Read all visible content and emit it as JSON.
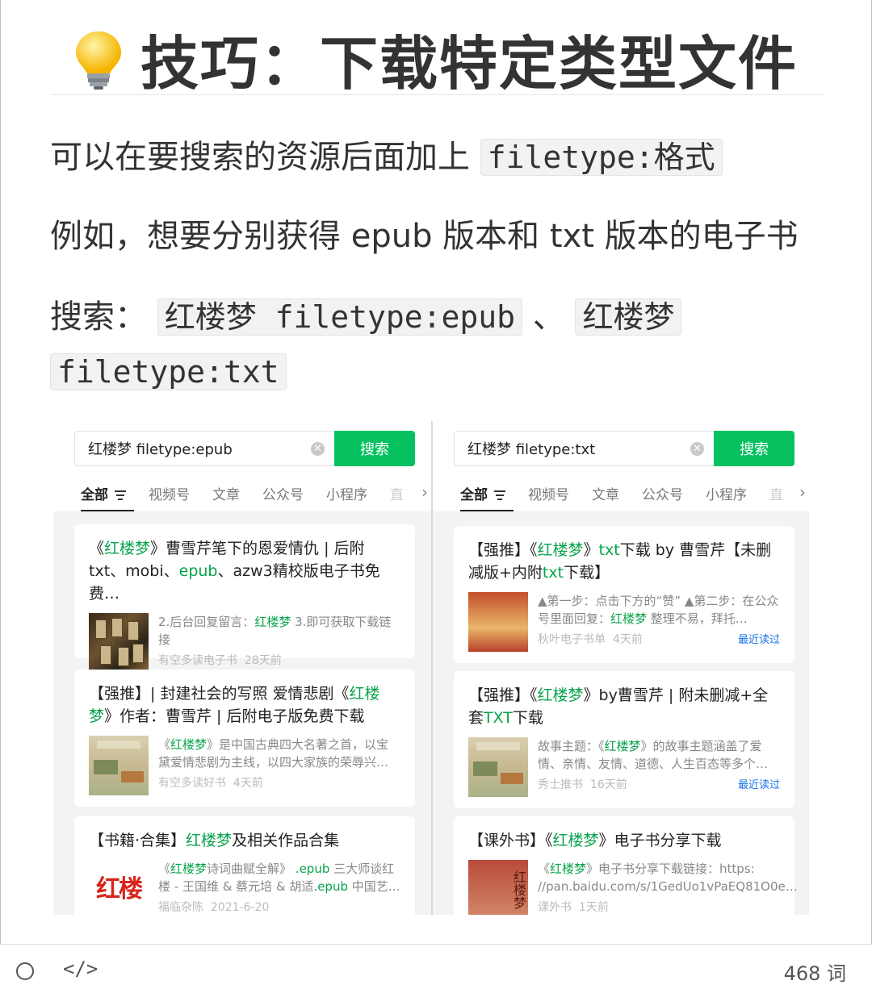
{
  "heading": {
    "text": "技巧：下载特定类型文件",
    "icon": "lightbulb-icon"
  },
  "paragraphs": {
    "p1_text": "可以在要搜索的资源后面加上",
    "p1_code": "filetype:格式",
    "p2_text": "例如，想要分别获得 epub 版本和 txt 版本的电子书",
    "p3_label": "搜索：",
    "p3_code1": "红楼梦 filetype:epub",
    "p3_sep": "、",
    "p3_code2a": "红楼梦",
    "p4_code2b": "filetype:txt"
  },
  "left_panel": {
    "search_value": "红楼梦 filetype:epub",
    "search_button": "搜索",
    "tabs": [
      "全部",
      "视频号",
      "文章",
      "公众号",
      "小程序",
      "直"
    ],
    "cards": [
      {
        "title_pre": "《",
        "title_hl": "红楼梦",
        "title_post": "》曹雪芹笔下的恩爱情仇 | 后附txt、mobi、",
        "title_hl2": "epub",
        "title_post2": "、azw3精校版电子书免费…",
        "snippet_pre": "2.后台回复留言：",
        "snippet_hl": "红楼梦",
        "snippet_post": " 3.即可获取下载链接",
        "source": "有空多读电子书",
        "time": "28天前"
      },
      {
        "title_pre": "【强推】| 封建社会的写照 爱情悲剧《",
        "title_hl": "红楼梦",
        "title_post": "》作者：曹雪芹 | 后附电子版免费下载",
        "snippet_pre": "《",
        "snippet_hl": "红楼梦",
        "snippet_post": "》是中国古典四大名著之首，以宝黛爱情悲剧为主线，以四大家族的荣辱兴…",
        "source": "有空多读好书",
        "time": "4天前"
      },
      {
        "title_pre": "【书籍·合集】",
        "title_hl": "红楼梦",
        "title_post": "及相关作品合集",
        "snippet_pre": "《",
        "snippet_hl": "红楼梦",
        "snippet_mid": "诗词曲赋全解》 ",
        "snippet_hl2": ".epub",
        "snippet_mid2": " 三大师谈红楼 - 王国维 & 蔡元培 & 胡适",
        "snippet_hl3": ".epub",
        "snippet_post": " 中国艺…",
        "source": "福临杂陈",
        "time": "2021-6-20",
        "thumb_text": "红楼"
      }
    ]
  },
  "right_panel": {
    "search_value": "红楼梦 filetype:txt",
    "search_button": "搜索",
    "tabs": [
      "全部",
      "视频号",
      "文章",
      "公众号",
      "小程序",
      "直"
    ],
    "cards": [
      {
        "title_pre": "【强推】《",
        "title_hl": "红楼梦",
        "title_mid": "》",
        "title_hl2": "txt",
        "title_mid2": "下载 by 曹雪芹【未删减版+内附",
        "title_hl3": "txt",
        "title_post": "下载】",
        "snippet_pre": "▲第一步：点击下方的“赞” ▲第二步：在公众号里面回复：",
        "snippet_hl": "红楼梦",
        "snippet_post": " 整理不易，拜托…",
        "source": "秋叶电子书单",
        "time": "4天前",
        "recent": "最近读过"
      },
      {
        "title_pre": "【强推】《",
        "title_hl": "红楼梦",
        "title_mid": "》by曹雪芹 | 附未删减+全套",
        "title_hl2": "TXT",
        "title_post": "下载",
        "snippet_pre": "故事主题：《",
        "snippet_hl": "红楼梦",
        "snippet_post": "》的故事主题涵盖了爱情、亲情、友情、道德、人生百态等多个…",
        "source": "秀士推书",
        "time": "16天前",
        "recent": "最近读过"
      },
      {
        "title_pre": "【课外书】《",
        "title_hl": "红楼梦",
        "title_post": "》电子书分享下载",
        "snippet_pre": "《",
        "snippet_hl": "红楼梦",
        "snippet_post": "》电子书分享下载链接：https: //pan.baidu.com/s/1GedUo1vPaEQ81O0e…",
        "source": "课外书",
        "time": "1天前",
        "thumb_text": "红楼梦"
      }
    ]
  },
  "status_bar": {
    "word_count": "468 词"
  },
  "colors": {
    "accent_green": "#07c160",
    "highlight_green": "#07a34a",
    "link_blue": "#1a73e8"
  }
}
